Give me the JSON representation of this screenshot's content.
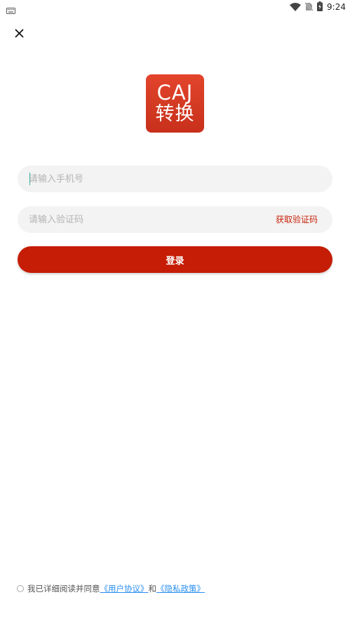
{
  "status_bar": {
    "time": "9:24",
    "icons": [
      "keyboard-icon",
      "wifi-icon",
      "no-sim-icon",
      "battery-charging-icon"
    ]
  },
  "header": {
    "close_icon": "close-icon"
  },
  "logo": {
    "line1": "CAJ",
    "line2": "转换",
    "color": "#d83c24"
  },
  "form": {
    "phone_placeholder": "请输入手机号",
    "phone_value": "",
    "code_placeholder": "请输入验证码",
    "code_value": "",
    "get_code_label": "获取验证码",
    "login_label": "登录"
  },
  "agreement": {
    "prefix": "我已详细阅读并同意",
    "user_agreement": "《用户协议》",
    "connector": "和",
    "privacy_policy": "《隐私政策》",
    "checked": false
  },
  "colors": {
    "accent": "#c51d06",
    "link": "#2a8ff0",
    "field_bg": "#f3f3f3"
  }
}
